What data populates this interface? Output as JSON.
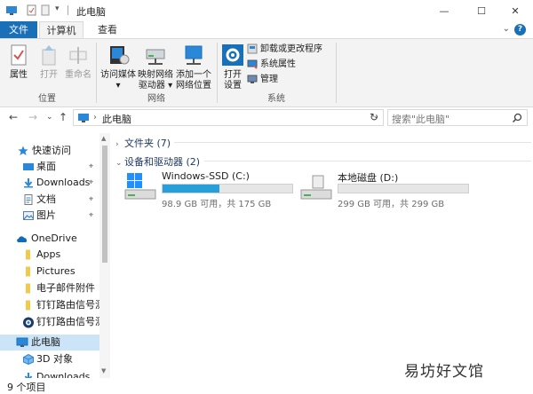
{
  "titlebar": {
    "title": "此电脑",
    "minimize_glyph": "—",
    "maximize_glyph": "☐",
    "close_glyph": "✕"
  },
  "tabs": {
    "file": "文件",
    "computer": "计算机",
    "view": "查看",
    "collapse_glyph": "⌄",
    "help_glyph": "?"
  },
  "ribbon": {
    "location_group": {
      "label": "位置",
      "properties": "属性",
      "open": "打开",
      "rename": "重命名"
    },
    "network_group": {
      "label": "网络",
      "media": [
        "访问媒体",
        "▾"
      ],
      "map_drive": [
        "映射网络",
        "驱动器 ▾"
      ],
      "add_location": [
        "添加一个",
        "网络位置"
      ]
    },
    "system_group": {
      "label": "系统",
      "open_settings": [
        "打开",
        "设置"
      ],
      "uninstall": "卸载或更改程序",
      "system_properties": "系统属性",
      "manage": "管理"
    }
  },
  "navigation": {
    "back": "←",
    "forward": "→",
    "recent": "⌄",
    "up": "↑",
    "path_separator": "›",
    "address": "此电脑",
    "address_dropdown": "⌄",
    "refresh": "↻",
    "search_placeholder": "搜索\"此电脑\""
  },
  "sidebar": {
    "items": [
      {
        "label": "快速访问",
        "icon": "star-icon"
      },
      {
        "label": "桌面",
        "icon": "desktop-icon",
        "pinned": true
      },
      {
        "label": "Downloads",
        "icon": "download-icon",
        "pinned": true
      },
      {
        "label": "文档",
        "icon": "document-icon",
        "pinned": true
      },
      {
        "label": "图片",
        "icon": "picture-icon",
        "pinned": true
      },
      {
        "label": "OneDrive",
        "icon": "cloud-icon"
      },
      {
        "label": "Apps",
        "icon": "folder-icon"
      },
      {
        "label": "Pictures",
        "icon": "folder-icon"
      },
      {
        "label": "电子邮件附件",
        "icon": "folder-icon"
      },
      {
        "label": "钉钉路由信号测试",
        "icon": "folder-icon"
      },
      {
        "label": "钉钉路由信号测试",
        "icon": "app-icon"
      },
      {
        "label": "此电脑",
        "icon": "computer-icon",
        "selected": true
      },
      {
        "label": "3D 对象",
        "icon": "cube-icon"
      },
      {
        "label": "Downloads",
        "icon": "download-icon"
      }
    ],
    "pin_glyph": "📌",
    "scroll_up": "▲",
    "scroll_down": "▼"
  },
  "content": {
    "folders_section": "文件夹 (7)",
    "devices_section": "设备和驱动器 (2)",
    "drives": [
      {
        "name": "Windows-SSD (C:)",
        "usage_fraction": 0.435,
        "info": "98.9 GB 可用，共 175 GB",
        "icon": "windows-drive-icon"
      },
      {
        "name": "本地磁盘 (D:)",
        "usage_fraction": 0.0,
        "info": "299 GB 可用，共 299 GB",
        "icon": "hard-drive-icon"
      }
    ]
  },
  "status": {
    "item_count": "9 个项目"
  },
  "watermark": "易坊好文馆",
  "colors": {
    "accent": "#1a6fb9",
    "drive_fill": "#26a0da",
    "selected": "#cce4f7"
  }
}
